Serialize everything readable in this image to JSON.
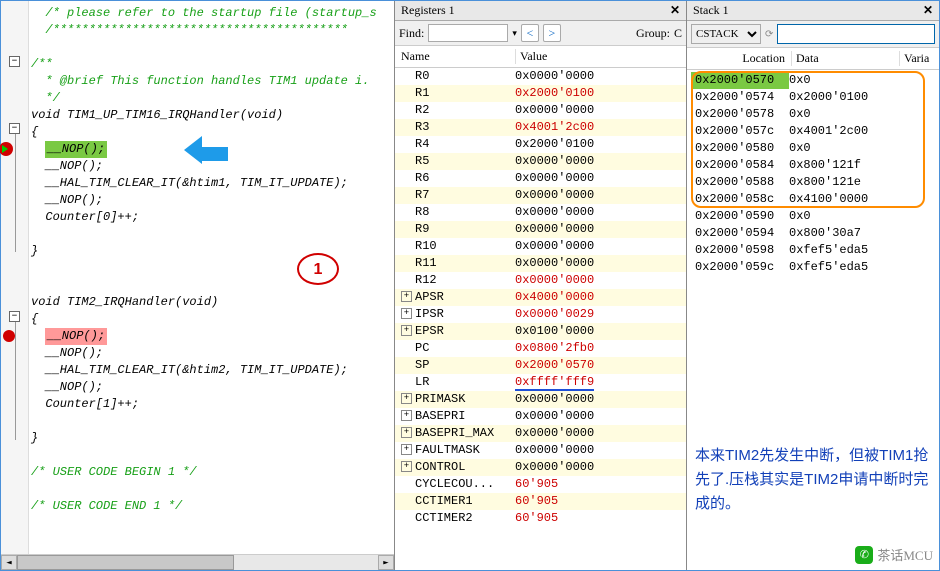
{
  "code": {
    "lines": [
      {
        "t": "  /* please refer to the startup file (startup_s",
        "cls": "comment"
      },
      {
        "t": "  /*****************************************",
        "cls": "comment"
      },
      {
        "t": "",
        "cls": ""
      },
      {
        "t": "/**",
        "cls": "comment"
      },
      {
        "t": "  * @brief This function handles TIM1 update i.",
        "cls": "comment"
      },
      {
        "t": "  */",
        "cls": "comment"
      },
      {
        "t": "void TIM1_UP_TIM16_IRQHandler(void)",
        "cls": "plain"
      },
      {
        "t": "{",
        "cls": "plain"
      },
      {
        "t": "  __NOP();",
        "cls": "plain",
        "hl": "green"
      },
      {
        "t": "  __NOP();",
        "cls": "plain"
      },
      {
        "t": "  __HAL_TIM_CLEAR_IT(&htim1, TIM_IT_UPDATE);",
        "cls": "plain"
      },
      {
        "t": "  __NOP();",
        "cls": "plain"
      },
      {
        "t": "  Counter[0]++;",
        "cls": "plain"
      },
      {
        "t": "",
        "cls": ""
      },
      {
        "t": "}",
        "cls": "plain"
      },
      {
        "t": "",
        "cls": ""
      },
      {
        "t": "",
        "cls": ""
      },
      {
        "t": "void TIM2_IRQHandler(void)",
        "cls": "plain"
      },
      {
        "t": "{",
        "cls": "plain"
      },
      {
        "t": "  __NOP();",
        "cls": "plain",
        "hl": "red"
      },
      {
        "t": "  __NOP();",
        "cls": "plain"
      },
      {
        "t": "  __HAL_TIM_CLEAR_IT(&htim2, TIM_IT_UPDATE);",
        "cls": "plain"
      },
      {
        "t": "  __NOP();",
        "cls": "plain"
      },
      {
        "t": "  Counter[1]++;",
        "cls": "plain"
      },
      {
        "t": "",
        "cls": ""
      },
      {
        "t": "}",
        "cls": "plain"
      },
      {
        "t": "",
        "cls": ""
      },
      {
        "t": "/* USER CODE BEGIN 1 */",
        "cls": "comment"
      },
      {
        "t": "",
        "cls": ""
      },
      {
        "t": "/* USER CODE END 1 */",
        "cls": "comment"
      }
    ],
    "circle_label": "1"
  },
  "registers": {
    "title": "Registers 1",
    "find_label": "Find:",
    "group_label": "Group:",
    "group_value": "C",
    "col_name": "Name",
    "col_value": "Value",
    "rows": [
      {
        "n": "R0",
        "v": "0x0000'0000",
        "r": false
      },
      {
        "n": "R1",
        "v": "0x2000'0100",
        "r": true
      },
      {
        "n": "R2",
        "v": "0x0000'0000",
        "r": false
      },
      {
        "n": "R3",
        "v": "0x4001'2c00",
        "r": true
      },
      {
        "n": "R4",
        "v": "0x2000'0100",
        "r": false
      },
      {
        "n": "R5",
        "v": "0x0000'0000",
        "r": false
      },
      {
        "n": "R6",
        "v": "0x0000'0000",
        "r": false
      },
      {
        "n": "R7",
        "v": "0x0000'0000",
        "r": false
      },
      {
        "n": "R8",
        "v": "0x0000'0000",
        "r": false
      },
      {
        "n": "R9",
        "v": "0x0000'0000",
        "r": false
      },
      {
        "n": "R10",
        "v": "0x0000'0000",
        "r": false
      },
      {
        "n": "R11",
        "v": "0x0000'0000",
        "r": false
      },
      {
        "n": "R12",
        "v": "0x0000'0000",
        "r": true
      },
      {
        "n": "APSR",
        "v": "0x4000'0000",
        "r": true,
        "exp": true
      },
      {
        "n": "IPSR",
        "v": "0x0000'0029",
        "r": true,
        "exp": true
      },
      {
        "n": "EPSR",
        "v": "0x0100'0000",
        "r": false,
        "exp": true
      },
      {
        "n": "PC",
        "v": "0x0800'2fb0",
        "r": true
      },
      {
        "n": "SP",
        "v": "0x2000'0570",
        "r": true
      },
      {
        "n": "LR",
        "v": "0xffff'fff9",
        "r": true,
        "under": true
      },
      {
        "n": "PRIMASK",
        "v": "0x0000'0000",
        "r": false,
        "exp": true
      },
      {
        "n": "BASEPRI",
        "v": "0x0000'0000",
        "r": false,
        "exp": true
      },
      {
        "n": "BASEPRI_MAX",
        "v": "0x0000'0000",
        "r": false,
        "exp": true
      },
      {
        "n": "FAULTMASK",
        "v": "0x0000'0000",
        "r": false,
        "exp": true
      },
      {
        "n": "CONTROL",
        "v": "0x0000'0000",
        "r": false,
        "exp": true
      },
      {
        "n": "CYCLECOU...",
        "v": "60'905",
        "r": true
      },
      {
        "n": "CCTIMER1",
        "v": "60'905",
        "r": true
      },
      {
        "n": "CCTIMER2",
        "v": "60'905",
        "r": true
      }
    ]
  },
  "stack": {
    "title": "Stack 1",
    "select_value": "CSTACK",
    "col_loc": "Location",
    "col_data": "Data",
    "col_var": "Varia",
    "rows": [
      {
        "l": "0x2000'0570",
        "d": "0x0",
        "sel": true
      },
      {
        "l": "0x2000'0574",
        "d": "0x2000'0100"
      },
      {
        "l": "0x2000'0578",
        "d": "0x0"
      },
      {
        "l": "0x2000'057c",
        "d": "0x4001'2c00"
      },
      {
        "l": "0x2000'0580",
        "d": "0x0"
      },
      {
        "l": "0x2000'0584",
        "d": "0x800'121f"
      },
      {
        "l": "0x2000'0588",
        "d": "0x800'121e"
      },
      {
        "l": "0x2000'058c",
        "d": "0x4100'0000"
      },
      {
        "l": "0x2000'0590",
        "d": "0x0"
      },
      {
        "l": "0x2000'0594",
        "d": "0x800'30a7"
      },
      {
        "l": "0x2000'0598",
        "d": "0xfef5'eda5"
      },
      {
        "l": "0x2000'059c",
        "d": "0xfef5'eda5"
      }
    ],
    "note": "本来TIM2先发生中断，但被TIM1抢先了.压栈其实是TIM2申请中断时完成的。",
    "watermark": "茶话MCU"
  }
}
